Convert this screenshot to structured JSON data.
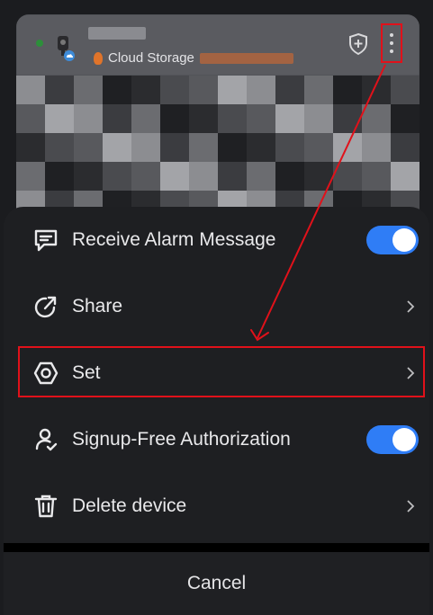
{
  "device_card": {
    "cloud_storage_label": "Cloud Storage"
  },
  "menu": {
    "items": [
      {
        "label": "Receive Alarm Message",
        "icon": "message-icon",
        "control": "toggle",
        "on": true
      },
      {
        "label": "Share",
        "icon": "share-icon",
        "control": "chevron"
      },
      {
        "label": "Set",
        "icon": "settings-icon",
        "control": "chevron"
      },
      {
        "label": "Signup-Free Authorization",
        "icon": "user-check-icon",
        "control": "toggle",
        "on": true
      },
      {
        "label": "Delete device",
        "icon": "trash-icon",
        "control": "chevron"
      }
    ],
    "cancel_label": "Cancel"
  },
  "colors": {
    "accent": "#2f7df6",
    "annotation": "#e1111a",
    "sheet_bg": "#1e1f22"
  }
}
